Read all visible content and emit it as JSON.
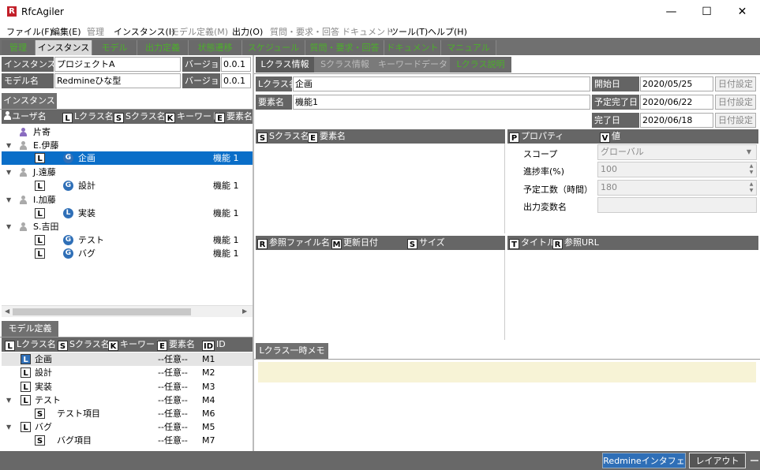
{
  "window": {
    "icon_letter": "R",
    "title": "RfcAgiler",
    "minimize": "—",
    "maximize": "☐",
    "close": "✕"
  },
  "menu": [
    {
      "label": "ファイル(F)",
      "enabled": true
    },
    {
      "label": "編集(E)",
      "enabled": true
    },
    {
      "label": "管理",
      "enabled": false
    },
    {
      "label": "インスタンス(I)",
      "enabled": true
    },
    {
      "label": "モデル定義(M)",
      "enabled": false
    },
    {
      "label": "出力(O)",
      "enabled": true
    },
    {
      "label": "質問・要求・回答",
      "enabled": false
    },
    {
      "label": "ドキュメント",
      "enabled": false
    },
    {
      "label": "ツール(T)",
      "enabled": true
    },
    {
      "label": "ヘルプ(H)",
      "enabled": true
    }
  ],
  "main_tabs": [
    "管理",
    "インスタンス",
    "モデル",
    "出力定義",
    "状態遷移",
    "スケジュール",
    "質問・要求・回答",
    "ドキュメント",
    "マニュアル"
  ],
  "main_tab_active": 1,
  "instance": {
    "name_label": "インスタンス名",
    "name_value": "プロジェクトA",
    "version_label": "バージョン",
    "version_value": "0.0.1"
  },
  "model": {
    "name_label": "モデル名",
    "name_value": "Redmineひな型",
    "version_label": "バージョン",
    "version_value": "0.0.1"
  },
  "instance_tab": "インスタンス",
  "instance_tree": {
    "headers": [
      {
        "badge": "",
        "label": "ユーザ名"
      },
      {
        "badge": "L",
        "label": "Lクラス名"
      },
      {
        "badge": "S",
        "label": "Sクラス名"
      },
      {
        "badge": "K",
        "label": "キーワード"
      },
      {
        "badge": "E",
        "label": "要素名"
      }
    ],
    "rows": [
      {
        "expander": "",
        "user": "片寄",
        "lclass": "",
        "sbadge": "",
        "sclass": "",
        "element": ""
      },
      {
        "expander": "▼",
        "user": "E.伊藤",
        "lclass": "",
        "sbadge": "",
        "sclass": "",
        "element": ""
      },
      {
        "expander": "",
        "user": "",
        "lclass": "L",
        "sbadge": "G",
        "sclass": "企画",
        "element": "機能 1"
      },
      {
        "expander": "▼",
        "user": "J.遠藤",
        "lclass": "",
        "sbadge": "",
        "sclass": "",
        "element": ""
      },
      {
        "expander": "",
        "user": "",
        "lclass": "L",
        "sbadge": "G",
        "sclass": "設計",
        "element": "機能 1"
      },
      {
        "expander": "▼",
        "user": "I.加藤",
        "lclass": "",
        "sbadge": "",
        "sclass": "",
        "element": ""
      },
      {
        "expander": "",
        "user": "",
        "lclass": "L",
        "sbadge": "L",
        "sclass": "実装",
        "element": "機能 1"
      },
      {
        "expander": "▼",
        "user": "S.吉田",
        "lclass": "",
        "sbadge": "",
        "sclass": "",
        "element": ""
      },
      {
        "expander": "",
        "user": "",
        "lclass": "L",
        "sbadge": "G",
        "sclass": "テスト",
        "element": "機能 1"
      },
      {
        "expander": "",
        "user": "",
        "lclass": "L",
        "sbadge": "G",
        "sclass": "バグ",
        "element": "機能 1"
      }
    ],
    "selected_row": 2
  },
  "model_tab": "モデル定義",
  "model_tree": {
    "headers": [
      {
        "badge": "L",
        "label": "Lクラス名"
      },
      {
        "badge": "S",
        "label": "Sクラス名"
      },
      {
        "badge": "K",
        "label": "キーワード"
      },
      {
        "badge": "E",
        "label": "要素名"
      },
      {
        "badge": "ID",
        "label": "ID"
      }
    ],
    "rows": [
      {
        "expander": "",
        "badge": "L",
        "name": "企画",
        "indent": 0,
        "element": "--任意--",
        "id": "M1"
      },
      {
        "expander": "",
        "badge": "L",
        "name": "設計",
        "indent": 0,
        "element": "--任意--",
        "id": "M2"
      },
      {
        "expander": "",
        "badge": "L",
        "name": "実装",
        "indent": 0,
        "element": "--任意--",
        "id": "M3"
      },
      {
        "expander": "▼",
        "badge": "L",
        "name": "テスト",
        "indent": 0,
        "element": "--任意--",
        "id": "M4"
      },
      {
        "expander": "",
        "badge": "S",
        "name": "テスト項目",
        "indent": 1,
        "element": "--任意--",
        "id": "M6"
      },
      {
        "expander": "▼",
        "badge": "L",
        "name": "バグ",
        "indent": 0,
        "element": "--任意--",
        "id": "M5"
      },
      {
        "expander": "",
        "badge": "S",
        "name": "バグ項目",
        "indent": 1,
        "element": "--任意--",
        "id": "M7"
      }
    ],
    "selected_row": 0
  },
  "right_tabs": [
    "Lクラス情報",
    "Sクラス情報",
    "キーワードデータ",
    "Lクラス説明"
  ],
  "right_tab_active": 0,
  "lclass": {
    "lclass_label": "Lクラス名",
    "lclass_value": "企画",
    "element_label": "要素名",
    "element_value": "機能1",
    "start_label": "開始日",
    "start_value": "2020/05/25",
    "planned_label": "予定完了日",
    "planned_value": "2020/06/22",
    "done_label": "完了日",
    "done_value": "2020/06/18",
    "date_button": "日付設定"
  },
  "sclass_table": {
    "headers": [
      {
        "badge": "S",
        "label": "Sクラス名"
      },
      {
        "badge": "E",
        "label": "要素名"
      }
    ]
  },
  "property_table": {
    "headers": [
      {
        "badge": "P",
        "label": "プロパティ"
      },
      {
        "badge": "V",
        "label": "値"
      }
    ],
    "rows": [
      {
        "label": "スコープ",
        "value": "グローバル",
        "kind": "dropdown"
      },
      {
        "label": "進捗率(%)",
        "value": "100",
        "kind": "spinner"
      },
      {
        "label": "予定工数（時間）",
        "value": "180",
        "kind": "spinner"
      },
      {
        "label": "出力変数名",
        "value": "",
        "kind": "text"
      }
    ]
  },
  "ref_table": {
    "headers": [
      {
        "badge": "R",
        "label": "参照ファイル名"
      },
      {
        "badge": "M",
        "label": "更新日付"
      },
      {
        "badge": "S",
        "label": "サイズ"
      }
    ]
  },
  "url_table": {
    "headers": [
      {
        "badge": "T",
        "label": "タイトル"
      },
      {
        "badge": "R",
        "label": "参照URL"
      }
    ]
  },
  "memo_tab": "Lクラス一時メモ",
  "status": {
    "redmine_button": "Redmineインタフェース",
    "layout_button": "レイアウト"
  },
  "colors": {
    "selection": "#0a6ec8",
    "badge_blue": "#2f6fb7",
    "tab_green": "#4caf2a",
    "memo_bg": "#f7f3d6"
  }
}
